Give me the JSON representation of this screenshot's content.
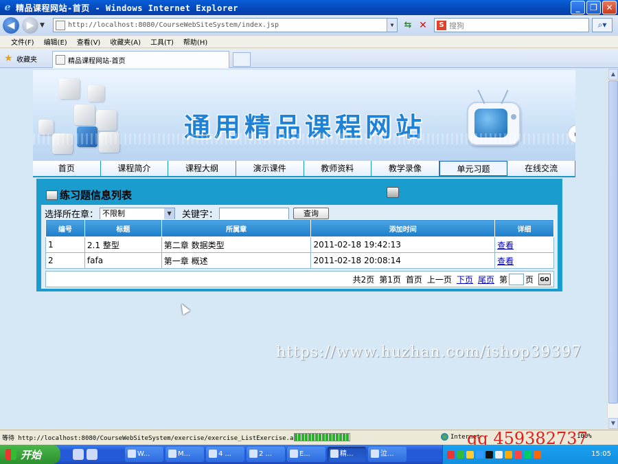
{
  "window": {
    "title": "精品课程网站-首页 - Windows Internet Explorer",
    "minimize": "_",
    "restore": "❐",
    "close": "✕"
  },
  "address": {
    "url": "http://localhost:8080/CourseWebSiteSystem/index.jsp",
    "search_placeholder": "搜狗"
  },
  "menu": [
    "文件(F)",
    "编辑(E)",
    "查看(V)",
    "收藏夹(A)",
    "工具(T)",
    "帮助(H)"
  ],
  "favorites": {
    "label": "收藏夹",
    "tab_title": "精品课程网站-首页"
  },
  "banner": {
    "title": "通用精品课程网站"
  },
  "nav": [
    "首页",
    "课程简介",
    "课程大纲",
    "演示课件",
    "教师资料",
    "教学录像",
    "单元习题",
    "在线交流"
  ],
  "nav_active_index": 6,
  "panel": {
    "title": "练习题信息列表",
    "filter_label": "选择所在章：",
    "chapter_selected": "不限制",
    "keyword_label": "关键字：",
    "keyword_value": "",
    "search_button": "查询"
  },
  "table": {
    "headers": [
      "编号",
      "标题",
      "所属章",
      "添加时间",
      "详细"
    ],
    "rows": [
      {
        "id": "1",
        "title": "2.1 整型",
        "chapter": "第二章 数据类型",
        "time": "2011-02-18 19:42:13",
        "detail": "查看"
      },
      {
        "id": "2",
        "title": "fafa",
        "chapter": "第一章 概述",
        "time": "2011-02-18 20:08:14",
        "detail": "查看"
      }
    ]
  },
  "pager": {
    "total": "共2页",
    "current": "第1页",
    "first": "首页",
    "prev": "上一页",
    "next": "下页",
    "last": "尾页",
    "goto_prefix": "第",
    "goto_suffix": "页",
    "go": "GO"
  },
  "watermark": "https://www.huzhan.com/ishop39397",
  "statusbar": {
    "text": "等待 http://localhost:8080/CourseWebSiteSystem/exercise/exercise_ListExercise.ac",
    "zone": "Internet",
    "zoom": "100%",
    "qq": "qq 459382737"
  },
  "taskbar": {
    "start": "开始",
    "tasks": [
      "W...",
      "M...",
      "4 ...",
      "2 ...",
      "E...",
      "精...",
      "泣..."
    ],
    "active_task_index": 5,
    "clock": "15:05"
  }
}
